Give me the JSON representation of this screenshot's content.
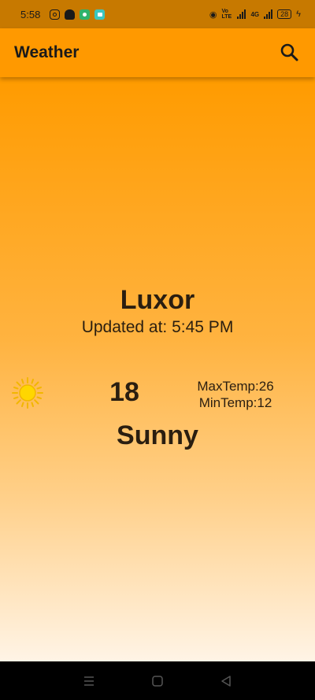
{
  "status_bar": {
    "time": "5:58",
    "network": "4G",
    "volte": "Vo LTE",
    "battery": "28"
  },
  "app_bar": {
    "title": "Weather",
    "search_icon": "search-icon"
  },
  "weather": {
    "city": "Luxor",
    "updated": "Updated at: 5:45 PM",
    "temperature": "18",
    "max_temp": "MaxTemp:26",
    "min_temp": "MinTemp:12",
    "condition": "Sunny",
    "condition_icon": "sun-icon"
  },
  "colors": {
    "status_bar": "#c77900",
    "app_bar": "#ff9900",
    "gradient_top": "#ff9b00",
    "gradient_bottom": "#fff4e6",
    "sun_core": "#ffd600",
    "sun_rays": "#f2b600"
  },
  "nav_bar": {
    "icons": [
      "menu-icon",
      "home-icon",
      "back-icon"
    ]
  }
}
